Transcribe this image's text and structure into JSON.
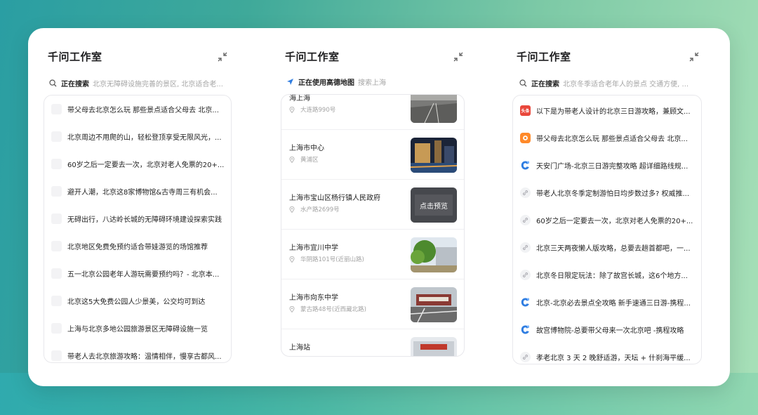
{
  "panels": {
    "left": {
      "title": "千问工作室",
      "status": "正在搜索",
      "query": "北京无障碍设施完善的景区, 北京适合老...",
      "items": [
        {
          "icon": "blank",
          "text": "带父母去北京怎么玩 那些景点适合父母去 北京..."
        },
        {
          "icon": "blank",
          "text": "北京周边不用爬的山，轻松登顶享受无限风光，..."
        },
        {
          "icon": "blank",
          "text": "60岁之后一定要去一次，北京对老人免票的20+..."
        },
        {
          "icon": "blank",
          "text": "避开人潮，北京这8家博物馆&古寺周三有机会..."
        },
        {
          "icon": "blank",
          "text": "无碍出行，八达岭长城的无障碍环境建设探索实践"
        },
        {
          "icon": "blank",
          "text": "北京地区免费免预约适合带娃游览的场馆推荐"
        },
        {
          "icon": "blank",
          "text": "五一北京公园老年人游玩需要预约吗？- 北京本..."
        },
        {
          "icon": "blank",
          "text": "北京这5大免费公园人少景美，公交均可到达"
        },
        {
          "icon": "blank",
          "text": "上海与北京多地公园旅游景区无障碍设施一览"
        },
        {
          "icon": "blank",
          "text": "带老人去北京旅游攻略：温情相伴，慢享古都风..."
        }
      ]
    },
    "middle": {
      "title": "千问工作室",
      "status": "正在使用高德地图",
      "query": "搜索上海",
      "pois": [
        {
          "name": "海上海",
          "addr": "大连路990号",
          "thumb": "street"
        },
        {
          "name": "上海市中心",
          "addr": "黄浦区",
          "thumb": "night"
        },
        {
          "name": "上海市宝山区杨行镇人民政府",
          "addr": "水产路2699号",
          "thumb": "preview",
          "overlay": "点击预览"
        },
        {
          "name": "上海市宜川中学",
          "addr": "华阴路101号(近丽山路)",
          "thumb": "tree"
        },
        {
          "name": "上海市向东中学",
          "addr": "蒙古路48号(近西藏北路)",
          "thumb": "school"
        },
        {
          "name": "上海站",
          "addr": "",
          "thumb": "station"
        }
      ]
    },
    "right": {
      "title": "千问工作室",
      "status": "正在搜索",
      "query": "北京冬季适合老年人的景点 交通方便, ...",
      "items": [
        {
          "icon": "red",
          "badge": "头条",
          "text": "以下是为带老人设计的北京三日游攻略，兼顾文..."
        },
        {
          "icon": "orange",
          "text": "带父母去北京怎么玩 那些景点适合父母去 北京..."
        },
        {
          "icon": "blue",
          "text": "天安门广场-北京三日游完整攻略 超详细路线规..."
        },
        {
          "icon": "link",
          "text": "带老人北京冬季定制游怕日均步数过多? 权威推..."
        },
        {
          "icon": "link",
          "text": "60岁之后一定要去一次，北京对老人免票的20+..."
        },
        {
          "icon": "link",
          "text": "北京三天两夜懒人版攻略，总要去趟首都吧，一..."
        },
        {
          "icon": "link",
          "text": "北京冬日限定玩法：除了故宫长城，这6个地方..."
        },
        {
          "icon": "blue",
          "text": "北京-北京必去景点全攻略 新手速通三日游-携程..."
        },
        {
          "icon": "blue",
          "text": "故宫博物院-总要带父母来一次北京吧 -携程攻略"
        },
        {
          "icon": "link",
          "text": "孝老北京 3 天 2 晚舒适游，天坛 + 什刹海平缓..."
        }
      ]
    }
  },
  "colors": {
    "accent_blue": "#2f7de1",
    "badge_red": "#e9473b",
    "badge_orange": "#ff8a2a"
  }
}
